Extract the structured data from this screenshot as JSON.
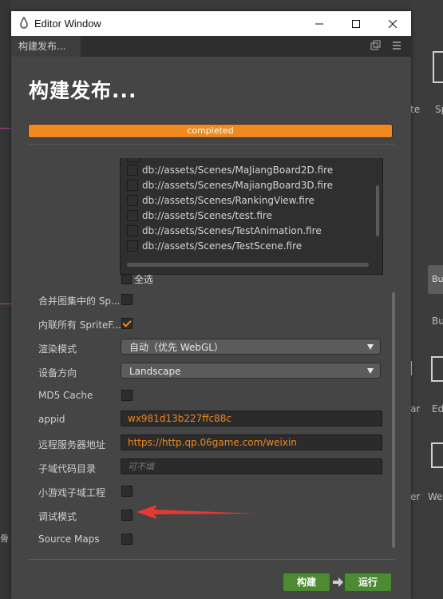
{
  "window": {
    "title": "Editor Window"
  },
  "tab": {
    "label": "构建发布..."
  },
  "heading": "构建发布...",
  "progress": {
    "value": 1.0,
    "label": "completed"
  },
  "scenes": [
    "db://assets/Scenes/MaJiangBoard2D.fire",
    "db://assets/Scenes/MajiangBoard3D.fire",
    "db://assets/Scenes/RankingView.fire",
    "db://assets/Scenes/test.fire",
    "db://assets/Scenes/TestAnimation.fire",
    "db://assets/Scenes/TestScene.fire"
  ],
  "select_all": "全选",
  "settings": {
    "merge_sprite": {
      "label": "合并图集中的 Sp...",
      "checked": false
    },
    "inline_sprite": {
      "label": "内联所有 SpriteF...",
      "checked": true
    },
    "render_mode": {
      "label": "渲染模式",
      "value": "自动（优先 WebGL）"
    },
    "orientation": {
      "label": "设备方向",
      "value": "Landscape"
    },
    "md5": {
      "label": "MD5 Cache",
      "checked": false
    },
    "appid": {
      "label": "appid",
      "value": "wx981d13b227ffc88c"
    },
    "remote_server": {
      "label": "远程服务器地址",
      "value": "https://http.qp.06game.com/weixin"
    },
    "subdomain_dir": {
      "label": "子域代码目录",
      "placeholder": "可不填"
    },
    "subdomain_project": {
      "label": "小游戏子域工程",
      "checked": false
    },
    "debug_mode": {
      "label": "调试模式",
      "checked": false
    },
    "source_maps": {
      "label": "Source Maps",
      "checked": false
    }
  },
  "buttons": {
    "build": "构建",
    "run": "运行"
  },
  "background": {
    "right_labels": [
      "te",
      "Sp",
      "Bu",
      "ar",
      "Ed",
      "er",
      "We"
    ],
    "left_label": "骨"
  },
  "colors": {
    "accent": "#f0891f",
    "button_green": "#4e8a33",
    "annotation_red": "#e53935"
  }
}
